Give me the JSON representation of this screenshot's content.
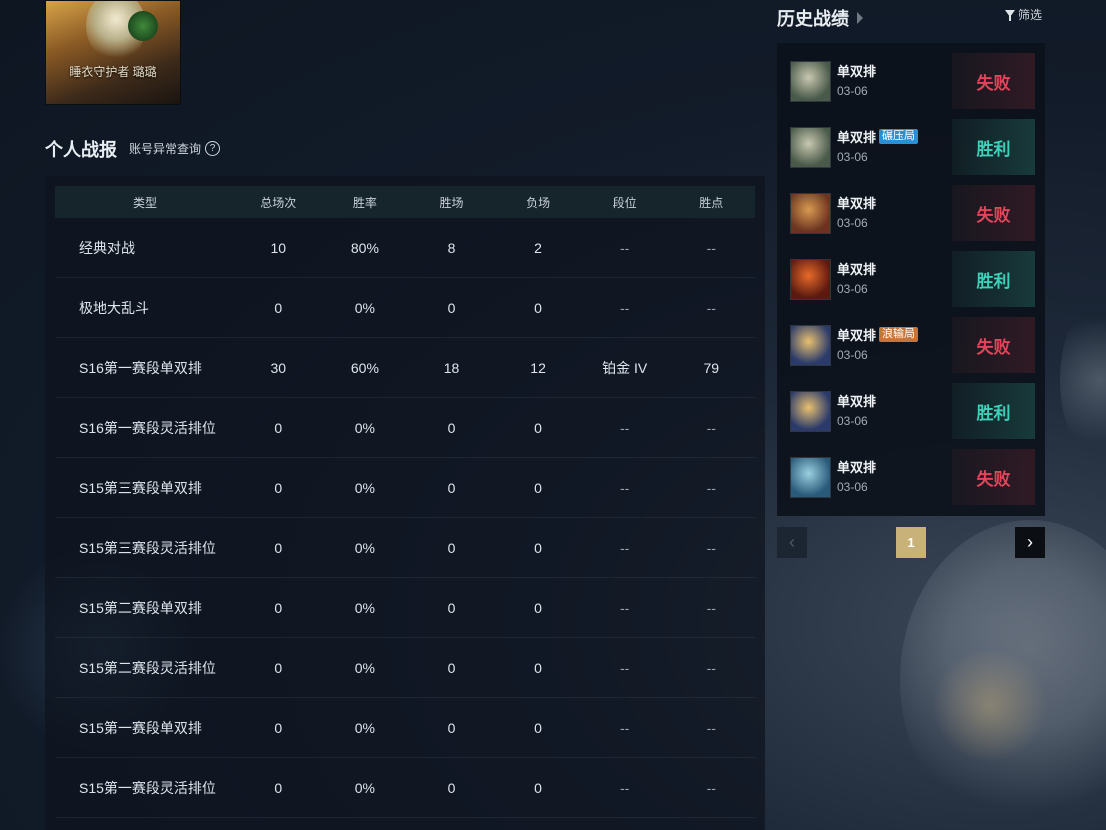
{
  "champion_card": {
    "skin_name": "睡衣守护者 璐璐"
  },
  "personal": {
    "title": "个人战报",
    "anomaly_link": "账号异常查询",
    "help_icon": "?"
  },
  "stats_table": {
    "headers": [
      "类型",
      "总场次",
      "胜率",
      "胜场",
      "负场",
      "段位",
      "胜点"
    ],
    "rows": [
      [
        "经典对战",
        "10",
        "80%",
        "8",
        "2",
        "--",
        "--"
      ],
      [
        "极地大乱斗",
        "0",
        "0%",
        "0",
        "0",
        "--",
        "--"
      ],
      [
        "S16第一赛段单双排",
        "30",
        "60%",
        "18",
        "12",
        "铂金 IV",
        "79"
      ],
      [
        "S16第一赛段灵活排位",
        "0",
        "0%",
        "0",
        "0",
        "--",
        "--"
      ],
      [
        "S15第三赛段单双排",
        "0",
        "0%",
        "0",
        "0",
        "--",
        "--"
      ],
      [
        "S15第三赛段灵活排位",
        "0",
        "0%",
        "0",
        "0",
        "--",
        "--"
      ],
      [
        "S15第二赛段单双排",
        "0",
        "0%",
        "0",
        "0",
        "--",
        "--"
      ],
      [
        "S15第二赛段灵活排位",
        "0",
        "0%",
        "0",
        "0",
        "--",
        "--"
      ],
      [
        "S15第一赛段单双排",
        "0",
        "0%",
        "0",
        "0",
        "--",
        "--"
      ],
      [
        "S15第一赛段灵活排位",
        "0",
        "0%",
        "0",
        "0",
        "--",
        "--"
      ]
    ]
  },
  "history": {
    "title": "历史战绩",
    "filter_label": "筛选",
    "matches": [
      {
        "mode": "单双排",
        "date": "03-06",
        "result": "失败",
        "outcome": "lose",
        "tag": "",
        "avatar_colors": [
          "#4a5a4a",
          "#c8c8b0"
        ]
      },
      {
        "mode": "单双排",
        "date": "03-06",
        "result": "胜利",
        "outcome": "win",
        "tag": "碾压局",
        "tag_color": "blue",
        "avatar_colors": [
          "#4a5a4a",
          "#c8c8b0"
        ]
      },
      {
        "mode": "单双排",
        "date": "03-06",
        "result": "失败",
        "outcome": "lose",
        "tag": "",
        "avatar_colors": [
          "#6a3420",
          "#d89a50"
        ]
      },
      {
        "mode": "单双排",
        "date": "03-06",
        "result": "胜利",
        "outcome": "win",
        "tag": "",
        "avatar_colors": [
          "#5a1a10",
          "#e86a2a"
        ]
      },
      {
        "mode": "单双排",
        "date": "03-06",
        "result": "失败",
        "outcome": "lose",
        "tag": "浪输局",
        "tag_color": "orange",
        "avatar_colors": [
          "#2a3a6a",
          "#e8c070"
        ]
      },
      {
        "mode": "单双排",
        "date": "03-06",
        "result": "胜利",
        "outcome": "win",
        "tag": "",
        "avatar_colors": [
          "#2a3a6a",
          "#e8c070"
        ]
      },
      {
        "mode": "单双排",
        "date": "03-06",
        "result": "失败",
        "outcome": "lose",
        "tag": "",
        "avatar_colors": [
          "#2a5a7a",
          "#9ad0e0"
        ]
      }
    ],
    "pagination": {
      "current_page": "1"
    }
  }
}
